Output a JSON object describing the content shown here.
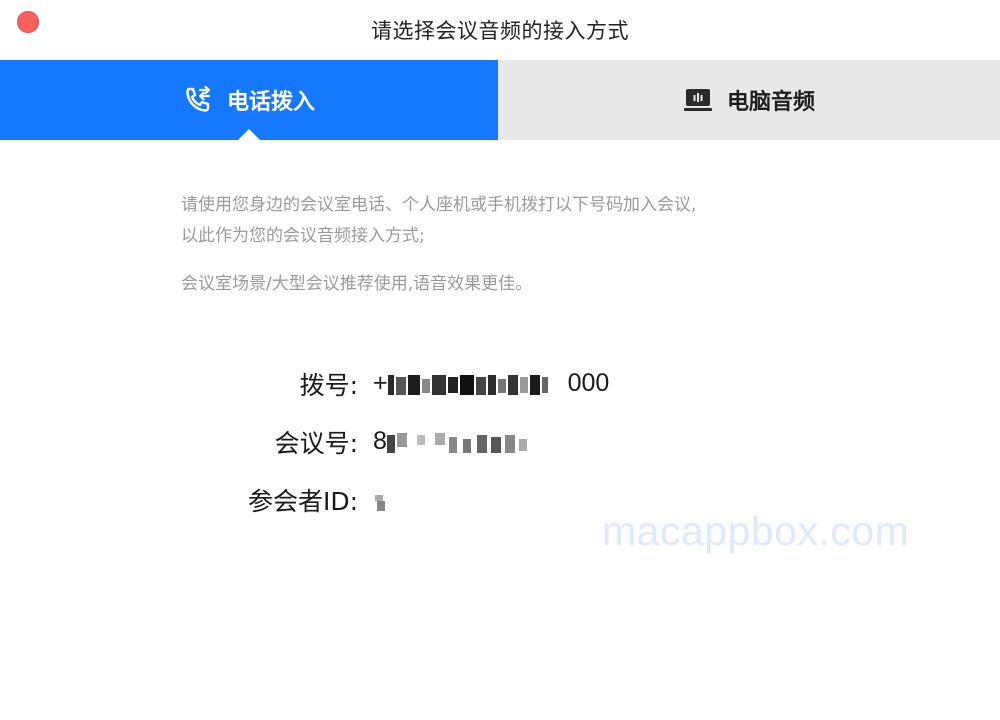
{
  "window": {
    "title": "请选择会议音频的接入方式"
  },
  "tabs": [
    {
      "label": "电话拨入",
      "icon": "phone-dial-icon",
      "active": true
    },
    {
      "label": "电脑音频",
      "icon": "computer-audio-icon",
      "active": false
    }
  ],
  "description": {
    "line1": "请使用您身边的会议室电话、个人座机或手机拨打以下号码加入会议,",
    "line2": "以此作为您的会议音频接入方式;",
    "note": "会议室场景/大型会议推荐使用,语音效果更佳。"
  },
  "info": {
    "dial_label": "拨号:",
    "dial_value_prefix": "+",
    "dial_value_suffix": "000",
    "meeting_label": "会议号:",
    "meeting_value_prefix": "8",
    "participant_label": "参会者ID:"
  },
  "watermark": "macappbox.com",
  "colors": {
    "accent": "#1677ff",
    "inactive_tab": "#e8e8e8",
    "close_button": "#fc605c",
    "muted_text": "#9a9a9a"
  }
}
